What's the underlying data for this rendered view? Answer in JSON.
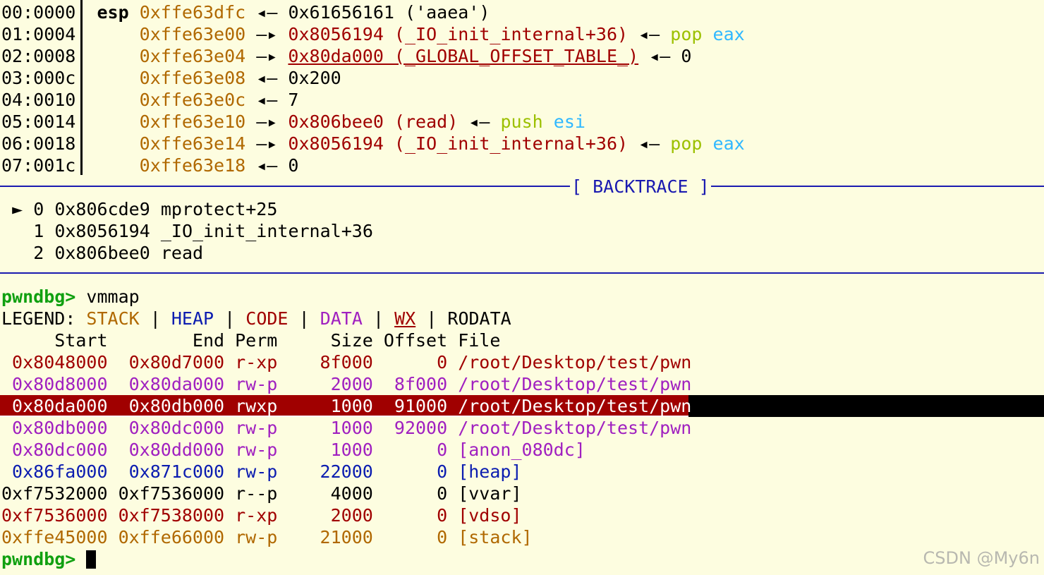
{
  "stack": {
    "rows": [
      {
        "idx": "00:0000",
        "reg": "esp",
        "addr": "0xffe63dfc",
        "arrow": "◂—",
        "val": "0x61656161 ('aaea')"
      },
      {
        "idx": "01:0004",
        "reg": "",
        "addr": "0xffe63e00",
        "arrow": "—▸",
        "val": "0x8056194 (_IO_init_internal+36)",
        "back": "◂—",
        "ins_op": "pop",
        "ins_arg": "eax"
      },
      {
        "idx": "02:0008",
        "reg": "",
        "addr": "0xffe63e04",
        "arrow": "—▸",
        "val": "0x80da000 (_GLOBAL_OFFSET_TABLE_)",
        "back": "◂—",
        "tail": "0"
      },
      {
        "idx": "03:000c",
        "reg": "",
        "addr": "0xffe63e08",
        "arrow": "◂—",
        "val": "0x200"
      },
      {
        "idx": "04:0010",
        "reg": "",
        "addr": "0xffe63e0c",
        "arrow": "◂—",
        "val": "7"
      },
      {
        "idx": "05:0014",
        "reg": "",
        "addr": "0xffe63e10",
        "arrow": "—▸",
        "val": "0x806bee0 (read)",
        "back": "◂—",
        "ins_op": "push",
        "ins_arg": "esi"
      },
      {
        "idx": "06:0018",
        "reg": "",
        "addr": "0xffe63e14",
        "arrow": "—▸",
        "val": "0x8056194 (_IO_init_internal+36)",
        "back": "◂—",
        "ins_op": "pop",
        "ins_arg": "eax"
      },
      {
        "idx": "07:001c",
        "reg": "",
        "addr": "0xffe63e18",
        "arrow": "◂—",
        "val": "0"
      }
    ]
  },
  "backtrace": {
    "label": "[ BACKTRACE ]",
    "frames": [
      {
        "marker": "►",
        "num": "0",
        "addr": "0x806cde9",
        "sym": "mprotect+25"
      },
      {
        "marker": " ",
        "num": "1",
        "addr": "0x8056194",
        "sym": "_IO_init_internal+36"
      },
      {
        "marker": " ",
        "num": "2",
        "addr": "0x806bee0",
        "sym": "read"
      }
    ]
  },
  "prompt": {
    "text": "pwndbg>",
    "command": "vmmap"
  },
  "legend": {
    "prefix": "LEGEND:",
    "stack": "STACK",
    "heap": "HEAP",
    "code": "CODE",
    "data": "DATA",
    "wx": "WX",
    "rodata": "RODATA",
    "sep": "|"
  },
  "vmmap": {
    "header": "     Start        End Perm     Size Offset File",
    "rows": [
      {
        "text": " 0x8048000  0x80d7000 r-xp    8f000      0 /root/Desktop/test/pwn",
        "kind": "code"
      },
      {
        "text": " 0x80d8000  0x80da000 rw-p     2000  8f000 /root/Desktop/test/pwn",
        "kind": "data"
      },
      {
        "text": " 0x80da000  0x80db000 rwxp     1000  91000 /root/Desktop/test/pwn",
        "kind": "wx"
      },
      {
        "text": " 0x80db000  0x80dc000 rw-p     1000  92000 /root/Desktop/test/pwn",
        "kind": "data"
      },
      {
        "text": " 0x80dc000  0x80dd000 rw-p     1000      0 [anon_080dc]",
        "kind": "data"
      },
      {
        "text": " 0x86fa000  0x871c000 rw-p    22000      0 [heap]",
        "kind": "heap"
      },
      {
        "text": "0xf7532000 0xf7536000 r--p     4000      0 [vvar]",
        "kind": "rodata"
      },
      {
        "text": "0xf7536000 0xf7538000 r-xp     2000      0 [vdso]",
        "kind": "code"
      },
      {
        "text": "0xffe45000 0xffe66000 rw-p    21000      0 [stack]",
        "kind": "stack"
      }
    ]
  },
  "prompt2": {
    "text": "pwndbg>"
  },
  "watermark": "CSDN @My6n",
  "colors": {
    "background": "#fdfde0",
    "code": "#a00000",
    "data": "#a020c0",
    "heap": "#0b1cb0",
    "stack": "#b06800",
    "prompt": "#10a010",
    "separator": "#1a1ab0"
  }
}
